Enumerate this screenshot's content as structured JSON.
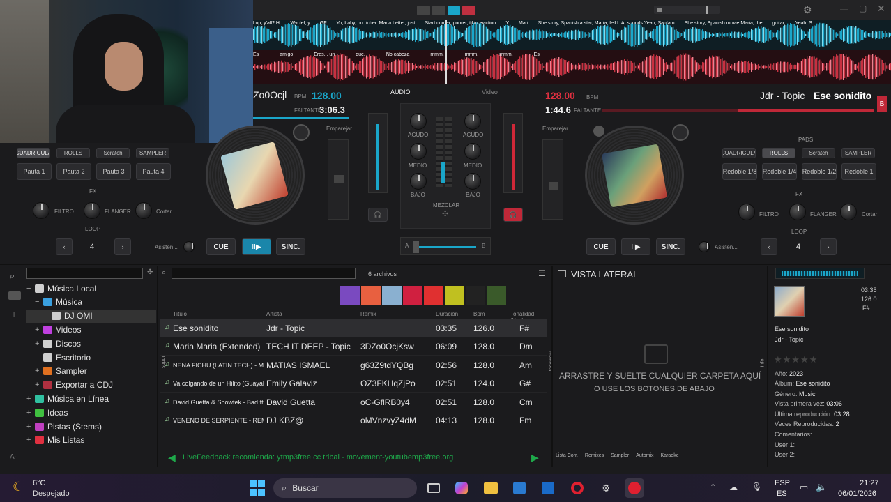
{
  "colors": {
    "deck_left": "#1aa6c9",
    "deck_right": "#e03040",
    "bg": "#1b1b1d",
    "taskbar": "#1e1b2e"
  },
  "waveform": {
    "lyrics_top": [
      "l up, y'all? Hi",
      "Wyclef, y",
      "GF",
      "Yo, baby, on richer. Maria better, just",
      "Start corner, poorer, til in eviction",
      "Y",
      "Mari",
      "She story, Spanish a star, Maria, fell L.A. sounds Yeah, Sanfam",
      "She story, Spanish movie Maria, the",
      "guitar,",
      "Yeah, S"
    ],
    "lyrics_bottom": [
      "Es",
      "amigo",
      "Eres... un",
      "que.",
      "No cabeza",
      "mmm,",
      "mmm.",
      "mmm,",
      "Es"
    ]
  },
  "deck_left": {
    "title": "Zo0Ocjl",
    "bpm_label": "BPM",
    "bpm": "128.00",
    "remaining_label": "FALTANTE",
    "remaining": "3:06.3",
    "pads_tabs": [
      "CUADRICULA",
      "ROLLS",
      "Scratch",
      "SAMPLER"
    ],
    "pads": [
      "Pauta 1",
      "Pauta 2",
      "Pauta 3",
      "Pauta 4"
    ],
    "fx_label": "FX",
    "fx": [
      "FILTRO",
      "FLANGER",
      "Cortar"
    ],
    "loop_label": "LOOP",
    "loop_value": "4",
    "assist": "Asisten...",
    "sync_match": "Emparejar",
    "cue": "CUE",
    "play": "II▶",
    "sync": "SINC."
  },
  "deck_right": {
    "artist": "Jdr - Topic",
    "title": "Ese sonidito",
    "bpm_label": "BPM",
    "bpm": "128.00",
    "remaining_label": "FALTANTE",
    "remaining": "1:44.6",
    "badge": "B",
    "pads_label": "PADS",
    "pads_tabs": [
      "CUADRICULA",
      "ROLLS",
      "Scratch",
      "SAMPLER"
    ],
    "pads": [
      "Redoble 1/8",
      "Redoble 1/4",
      "Redoble 1/2",
      "Redoble 1"
    ],
    "fx_label": "FX",
    "fx": [
      "FILTRO",
      "FLANGER",
      "Cortar"
    ],
    "loop_label": "LOOP",
    "loop_value": "4",
    "assist": "Asisten...",
    "sync_match": "Emparejar",
    "cue": "CUE",
    "play": "II▶",
    "sync": "SINC."
  },
  "mixer": {
    "tab_audio": "AUDIO",
    "tab_video": "Video",
    "eq": [
      "AGUDO",
      "MEDIO",
      "BAJO"
    ],
    "mixer_label": "MEZCLAR",
    "cross_a": "A",
    "cross_b": "B"
  },
  "browser": {
    "files_count": "6 archivos",
    "tree": [
      {
        "label": "Música Local",
        "icon": "#cfcfcf",
        "indent": 0,
        "exp": "−"
      },
      {
        "label": "Música",
        "icon": "#3aa0e0",
        "indent": 1,
        "exp": "−"
      },
      {
        "label": "DJ OMI",
        "icon": "#cfcfcf",
        "indent": 2,
        "exp": ""
      },
      {
        "label": "Videos",
        "icon": "#c040e0",
        "indent": 1,
        "exp": "+"
      },
      {
        "label": "Discos",
        "icon": "#cfcfcf",
        "indent": 1,
        "exp": "+"
      },
      {
        "label": "Escritorio",
        "icon": "#cfcfcf",
        "indent": 1,
        "exp": ""
      },
      {
        "label": "Sampler",
        "icon": "#e07020",
        "indent": 1,
        "exp": "+"
      },
      {
        "label": "Exportar a CDJ",
        "icon": "#b03040",
        "indent": 1,
        "exp": "+"
      },
      {
        "label": "Música en Línea",
        "icon": "#30c0a0",
        "indent": 0,
        "exp": "+"
      },
      {
        "label": "Ideas",
        "icon": "#40c040",
        "indent": 0,
        "exp": "+"
      },
      {
        "label": "Pistas (Stems)",
        "icon": "#c040c0",
        "indent": 0,
        "exp": "+"
      },
      {
        "label": "Mis Listas",
        "icon": "#e03040",
        "indent": 0,
        "exp": "+"
      }
    ],
    "columns": [
      "Título",
      "Artista",
      "Remix",
      "Duración",
      "Bpm",
      "Tonalidad (Key)"
    ],
    "tracks": [
      {
        "title": "Ese sonidito",
        "artist": "Jdr - Topic",
        "remix": "",
        "duration": "03:35",
        "bpm": "126.0",
        "key": "F#"
      },
      {
        "title": "Maria Maria (Extended)",
        "artist": "TECH IT DEEP - Topic",
        "remix": "3DZo0OcjKsw",
        "duration": "06:09",
        "bpm": "128.0",
        "key": "Dm"
      },
      {
        "title": "NENA FICHU (LATIN TECH) - Mati...",
        "artist": "MATIAS ISMAEL",
        "remix": "g63Z9tdYQBg",
        "duration": "02:56",
        "bpm": "128.0",
        "key": "Am"
      },
      {
        "title": "Va colgando de un Hilito (Guayabo...",
        "artist": "Emily Galaviz",
        "remix": "OZ3FKHqZjPo",
        "duration": "02:51",
        "bpm": "124.0",
        "key": "G#"
      },
      {
        "title": "David Guetta & Showtek - Bad ft.V...",
        "artist": "David Guetta",
        "remix": "oC-GflRB0y4",
        "duration": "02:51",
        "bpm": "128.0",
        "key": "Cm"
      },
      {
        "title": "VENENO DE SERPIENTE - REMI...",
        "artist": "DJ KBZ@",
        "remix": "oMVnzvyZ4dM",
        "duration": "04:13",
        "bpm": "128.0",
        "key": "Fm"
      }
    ],
    "livefeedback": "LiveFeedback recomienda: ytmp3free.cc tribal - movement-youtubemp3free.org",
    "side_labels": [
      "Todos",
      "Sideview",
      "Info"
    ]
  },
  "sideview": {
    "title": "VISTA LATERAL",
    "drop_line1": "ARRASTRE Y SUELTE CUALQUIER CARPETA AQUÍ",
    "drop_line2": "O USE LOS BOTONES DE ABAJO",
    "bottom": [
      "Lista Corr.",
      "Remixes",
      "Sampler",
      "Automix",
      "Karaoke"
    ]
  },
  "info": {
    "time": "03:35",
    "bpm": "126.0",
    "key": "F#",
    "title": "Ese sonidito",
    "artist": "Jdr - Topic",
    "year_label": "Año:",
    "year": "2023",
    "album_label": "Álbum:",
    "album": "Ese sonidito",
    "genre_label": "Género:",
    "genre": "Music",
    "first_seen_label": "Vista primera vez:",
    "first_seen": "03:06",
    "last_play_label": "Última reproducción:",
    "last_play": "03:28",
    "plays_label": "Veces Reproducidas:",
    "plays": "2",
    "comments_label": "Comentarios:",
    "user1_label": "User 1:",
    "user2_label": "User 2:"
  },
  "taskbar": {
    "temp": "6°C",
    "weather": "Despejado",
    "search": "Buscar",
    "lang1": "ESP",
    "lang2": "ES",
    "clock": "21:27",
    "date": "06/01/2026"
  }
}
